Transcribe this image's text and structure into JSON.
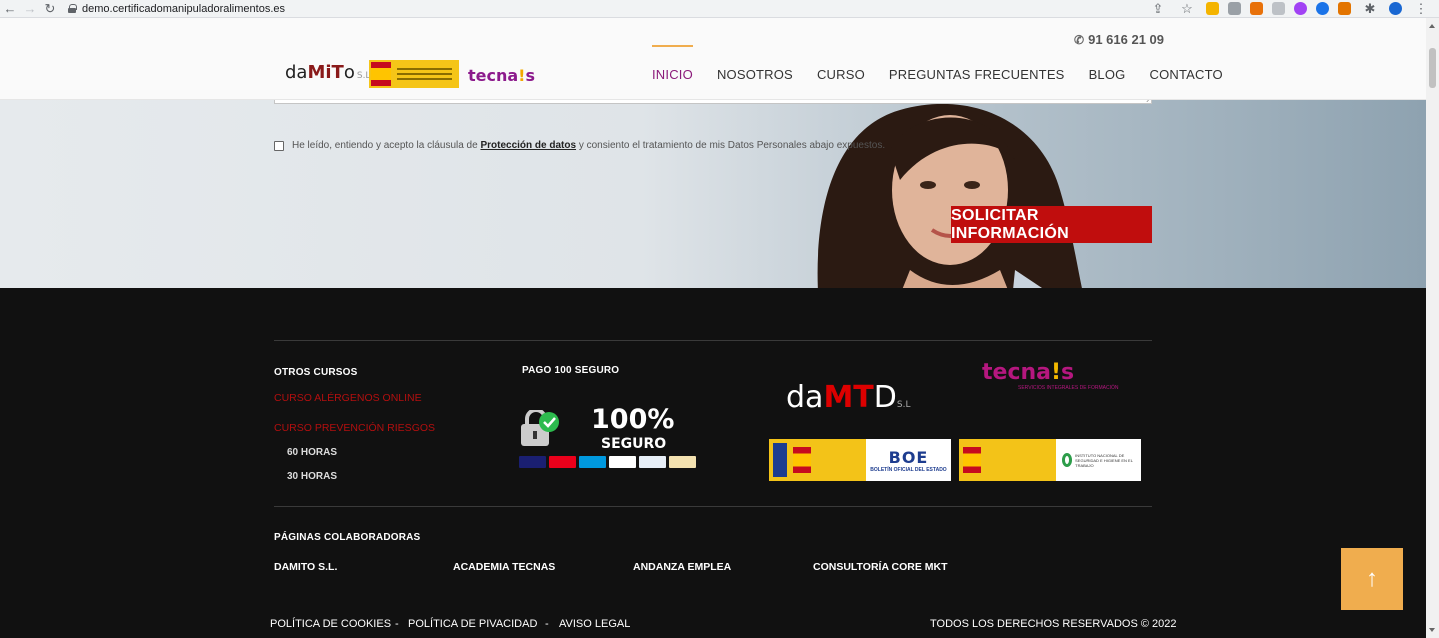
{
  "browser": {
    "url": "demo.certificadomanipuladoralimentos.es"
  },
  "header": {
    "phone": "91 616 21 09",
    "logo_damito": {
      "pre": "da",
      "mi": "MiT",
      "post": "o",
      "suffix": "S.L"
    },
    "logo_tecnas": {
      "text": "tecna",
      "bang": "!",
      "end": "s"
    },
    "nav": [
      {
        "label": "INICIO",
        "active": true
      },
      {
        "label": "NOSOTROS",
        "active": false
      },
      {
        "label": "CURSO",
        "active": false
      },
      {
        "label": "PREGUNTAS FRECUENTES",
        "active": false
      },
      {
        "label": "BLOG",
        "active": false
      },
      {
        "label": "CONTACTO",
        "active": false
      }
    ]
  },
  "form": {
    "consent_pre": "He leído, entiendo y acepto la cláusula de",
    "consent_link": "Protección de datos",
    "consent_post": "y consiento el tratamiento de mis Datos Personales abajo expuestos.",
    "submit_label": "SOLICITAR INFORMACIÓN"
  },
  "footer": {
    "otros_cursos": {
      "title": "OTROS CURSOS",
      "items": [
        "CURSO ALÉRGENOS ONLINE",
        "CURSO PREVENCIÓN RIESGOS"
      ],
      "sub": [
        "60 HORAS",
        "30 HORAS"
      ]
    },
    "pago": {
      "title": "PAGO 100 SEGURO",
      "badge_pct": "100%",
      "badge_word": "SEGURO"
    },
    "damito": {
      "pre": "da",
      "mid": "MT",
      "post": "D",
      "suffix": "S.L"
    },
    "tecnas": {
      "text": "tecna",
      "bang": "!",
      "end": "s",
      "sub": "SERVICIOS INTEGRALES DE FORMACIÓN"
    },
    "boe": {
      "big": "BOE",
      "small": "BOLETÍN OFICIAL DEL ESTADO"
    },
    "inst": "INSTITUTO NACIONAL DE SEGURIDAD E HIGIENE EN EL TRABAJO",
    "colaboradoras": {
      "title": "PÁGINAS COLABORADORAS",
      "links": [
        "DAMITO S.L.",
        "ACADEMIA TECNAS",
        "ANDANZA EMPLEA",
        "CONSULTORÍA CORE MKT"
      ]
    },
    "bottom": {
      "links": [
        "POLÍTICA DE COOKIES",
        "POLÍTICA DE PIVACIDAD",
        "AVISO LEGAL"
      ],
      "separator": "-",
      "copyright": "TODOS LOS DERECHOS RESERVADOS © 2022"
    },
    "to_top": "↑"
  },
  "colors": {
    "accent_orange": "#f0ad4e",
    "brand_red": "#c00d0d",
    "nav_active": "#8b1a7a",
    "footer_bg": "#111111"
  },
  "icons": [
    "back-arrow-icon",
    "forward-arrow-icon",
    "reload-icon",
    "lock-icon",
    "phone-icon",
    "checkbox-icon",
    "lock-secure-icon",
    "arrow-up-icon"
  ]
}
